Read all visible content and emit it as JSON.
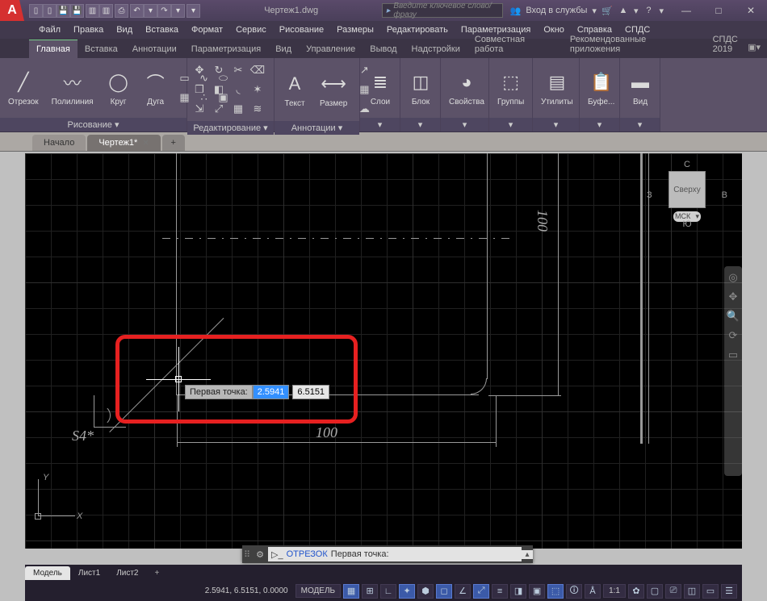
{
  "title": "Чертеж1.dwg",
  "search_placeholder": "Введите ключевое слово/фразу",
  "signin": "Вход в службы",
  "menus": [
    "Файл",
    "Правка",
    "Вид",
    "Вставка",
    "Формат",
    "Сервис",
    "Рисование",
    "Размеры",
    "Редактировать",
    "Параметризация",
    "Окно",
    "Справка",
    "СПДС"
  ],
  "ribbon_tabs": [
    "Главная",
    "Вставка",
    "Аннотации",
    "Параметризация",
    "Вид",
    "Управление",
    "Вывод",
    "Надстройки",
    "Совместная работа",
    "Рекомендованные приложения",
    "СПДС 2019"
  ],
  "ribbon": {
    "draw_label": "Рисование",
    "edit_label": "Редактирование",
    "anno_label": "Аннотации",
    "layer_label": "Слои",
    "block_label": "Блок",
    "props_label": "Свойства",
    "groups_label": "Группы",
    "util_label": "Утилиты",
    "buf_label": "Буфе...",
    "view_label": "Вид",
    "btn_line": "Отрезок",
    "btn_pline": "Полилиния",
    "btn_circle": "Круг",
    "btn_arc": "Дуга",
    "btn_text": "Текст",
    "btn_dim": "Размер"
  },
  "dtabs": {
    "home": "Начало",
    "active": "Чертеж1*"
  },
  "drawing": {
    "dim_h": "100",
    "dim_v": "100",
    "note": "S4*"
  },
  "tooltip": {
    "label": "Первая точка:",
    "x": "2.5941",
    "y": "6.5151"
  },
  "viewcube": {
    "face": "Сверху",
    "n": "С",
    "s": "Ю",
    "w": "З",
    "e": "В",
    "msk": "МСК"
  },
  "ucs": {
    "x": "X",
    "y": "Y"
  },
  "sheets": [
    "Модель",
    "Лист1",
    "Лист2"
  ],
  "cmd": {
    "name": "ОТРЕЗОК",
    "prompt": "Первая точка:"
  },
  "status": {
    "coords": "2.5941, 6.5151, 0.0000",
    "model": "МОДЕЛЬ",
    "scale": "1:1",
    "gear": "✿"
  }
}
